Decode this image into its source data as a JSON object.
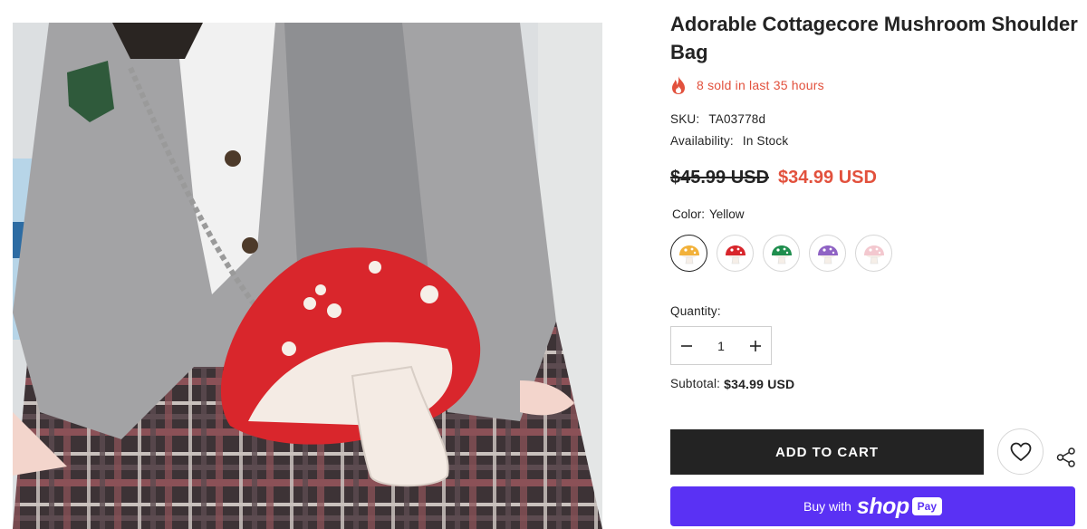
{
  "product": {
    "title": "Adorable Cottagecore Mushroom Shoulder Bag",
    "sold_text": "8 sold in last 35 hours",
    "sku_label": "SKU:",
    "sku": "TA03778d",
    "availability_label": "Availability:",
    "availability": "In Stock",
    "price_compare": "$45.99 USD",
    "price": "$34.99 USD",
    "color_label": "Color:",
    "color_selected": "Yellow",
    "swatches": [
      {
        "color": "#f2b13a",
        "selected": true
      },
      {
        "color": "#d8262c",
        "selected": false
      },
      {
        "color": "#1f8e4e",
        "selected": false
      },
      {
        "color": "#8f63c4",
        "selected": false
      },
      {
        "color": "#f3c8cf",
        "selected": false
      }
    ],
    "quantity_label": "Quantity:",
    "quantity": "1",
    "subtotal_label": "Subtotal:",
    "subtotal": "$34.99 USD"
  },
  "actions": {
    "add_to_cart": "ADD TO CART",
    "buy_with": "Buy with",
    "shop_word": "shop",
    "pay_word": "Pay"
  },
  "colors": {
    "accent_red": "#e2513d",
    "dark": "#232323",
    "shop_pay_purple": "#5a31f4"
  }
}
